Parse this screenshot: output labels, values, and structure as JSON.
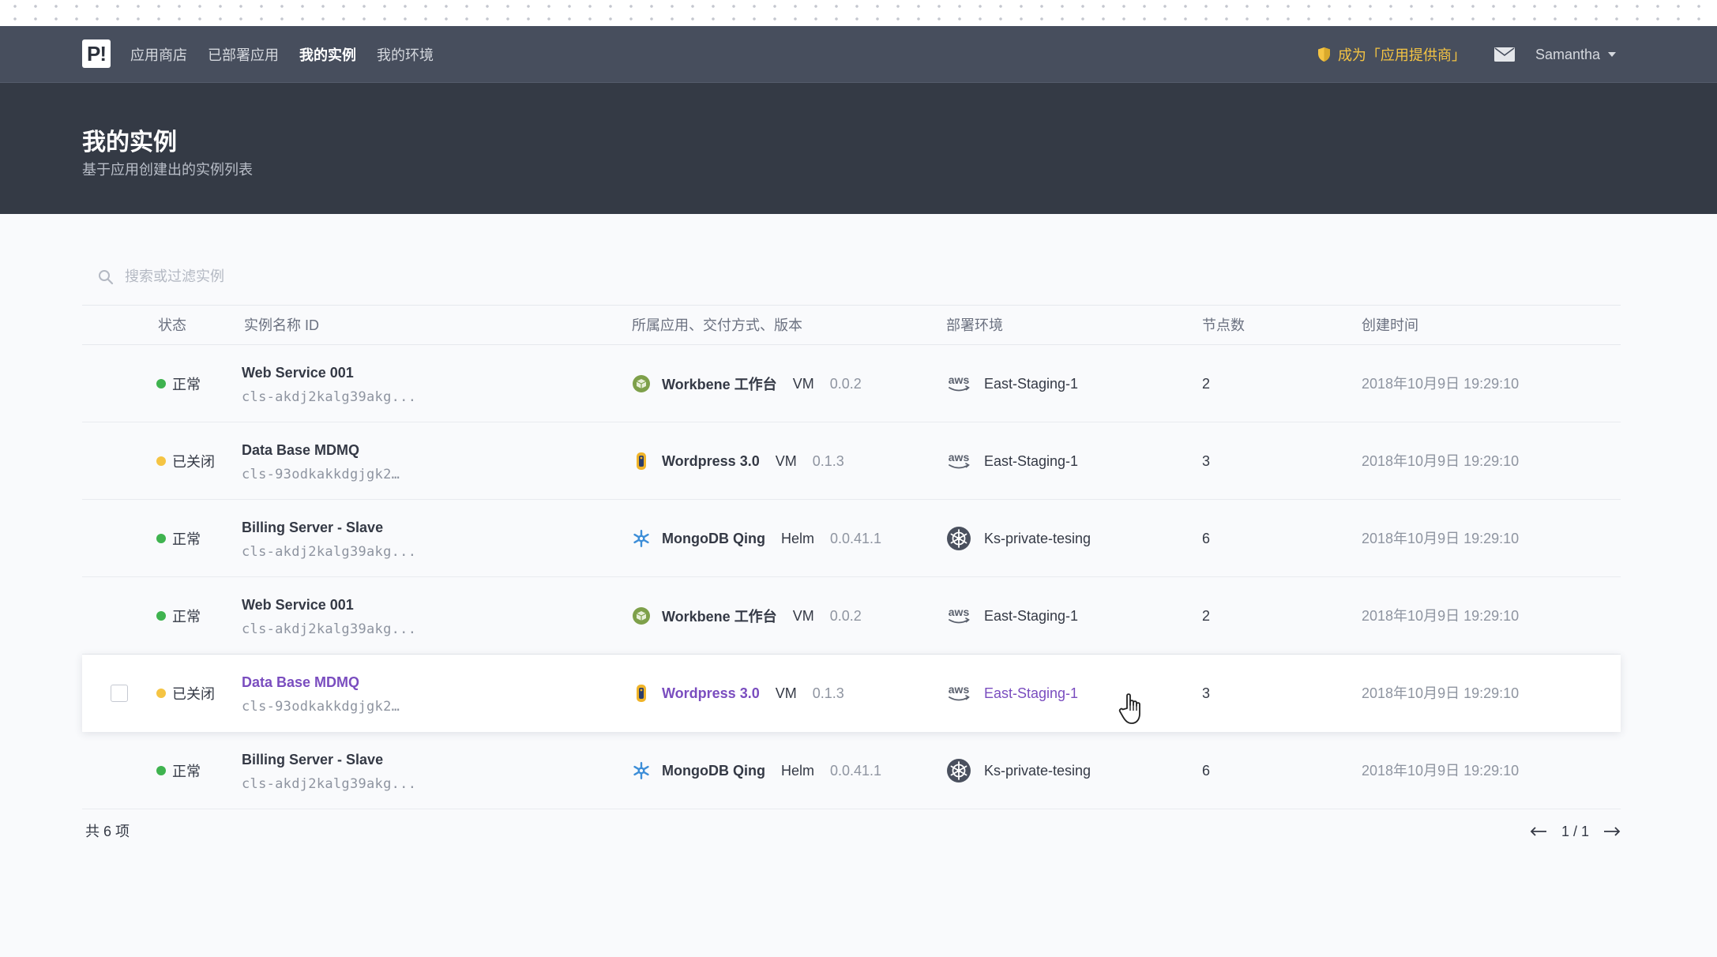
{
  "logo": {
    "text": "P!"
  },
  "nav": {
    "links": [
      {
        "label": "应用商店"
      },
      {
        "label": "已部署应用"
      },
      {
        "label": "我的实例"
      },
      {
        "label": "我的环境"
      }
    ],
    "provider_link": "成为「应用提供商」",
    "username": "Samantha"
  },
  "header": {
    "title": "我的实例",
    "subtitle": "基于应用创建出的实例列表"
  },
  "search": {
    "placeholder": "搜索或过滤实例",
    "value": ""
  },
  "table": {
    "columns": {
      "status": "状态",
      "name": "实例名称 ID",
      "app": "所属应用、交付方式、版本",
      "env": "部署环境",
      "nodes": "节点数",
      "created": "创建时间"
    },
    "rows": [
      {
        "status": "正常",
        "status_color": "#3fb34f",
        "name": "Web Service 001",
        "id": "cls-akdj2kalg39akg...",
        "app_icon": "workbench-icon",
        "app": "Workbene 工作台",
        "delivery": "VM",
        "version": "0.0.2",
        "env_icon": "aws-icon",
        "env": "East-Staging-1",
        "nodes": "2",
        "created": "2018年10月9日 19:29:10"
      },
      {
        "status": "已关闭",
        "status_color": "#f5c443",
        "name": "Data Base MDMQ",
        "id": "cls-93odkakkdgjgk2…",
        "app_icon": "wordpress-icon",
        "app": "Wordpress 3.0",
        "delivery": "VM",
        "version": "0.1.3",
        "env_icon": "aws-icon",
        "env": "East-Staging-1",
        "nodes": "3",
        "created": "2018年10月9日 19:29:10"
      },
      {
        "status": "正常",
        "status_color": "#3fb34f",
        "name": "Billing Server - Slave",
        "id": "cls-akdj2kalg39akg...",
        "app_icon": "mongodb-icon",
        "app": "MongoDB Qing",
        "delivery": "Helm",
        "version": "0.0.41.1",
        "env_icon": "kubernetes-icon",
        "env": "Ks-private-tesing",
        "nodes": "6",
        "created": "2018年10月9日 19:29:10"
      },
      {
        "status": "正常",
        "status_color": "#3fb34f",
        "name": "Web Service 001",
        "id": "cls-akdj2kalg39akg...",
        "app_icon": "workbench-icon",
        "app": "Workbene 工作台",
        "delivery": "VM",
        "version": "0.0.2",
        "env_icon": "aws-icon",
        "env": "East-Staging-1",
        "nodes": "2",
        "created": "2018年10月9日 19:29:10"
      },
      {
        "status": "已关闭",
        "status_color": "#f5c443",
        "name": "Data Base MDMQ",
        "id": "cls-93odkakkdgjgk2…",
        "app_icon": "wordpress-icon",
        "app": "Wordpress 3.0",
        "delivery": "VM",
        "version": "0.1.3",
        "env_icon": "aws-icon",
        "env": "East-Staging-1",
        "nodes": "3",
        "created": "2018年10月9日 19:29:10",
        "highlighted": true
      },
      {
        "status": "正常",
        "status_color": "#3fb34f",
        "name": "Billing Server - Slave",
        "id": "cls-akdj2kalg39akg...",
        "app_icon": "mongodb-icon",
        "app": "MongoDB Qing",
        "delivery": "Helm",
        "version": "0.0.41.1",
        "env_icon": "kubernetes-icon",
        "env": "Ks-private-tesing",
        "nodes": "6",
        "created": "2018年10月9日 19:29:10"
      }
    ]
  },
  "footer": {
    "total": "共 6 项",
    "page": "1 / 1"
  },
  "colors": {
    "accent": "#7a4dbf",
    "provider": "#f5c443",
    "navbar": "#474e5d",
    "header": "#343a45"
  }
}
